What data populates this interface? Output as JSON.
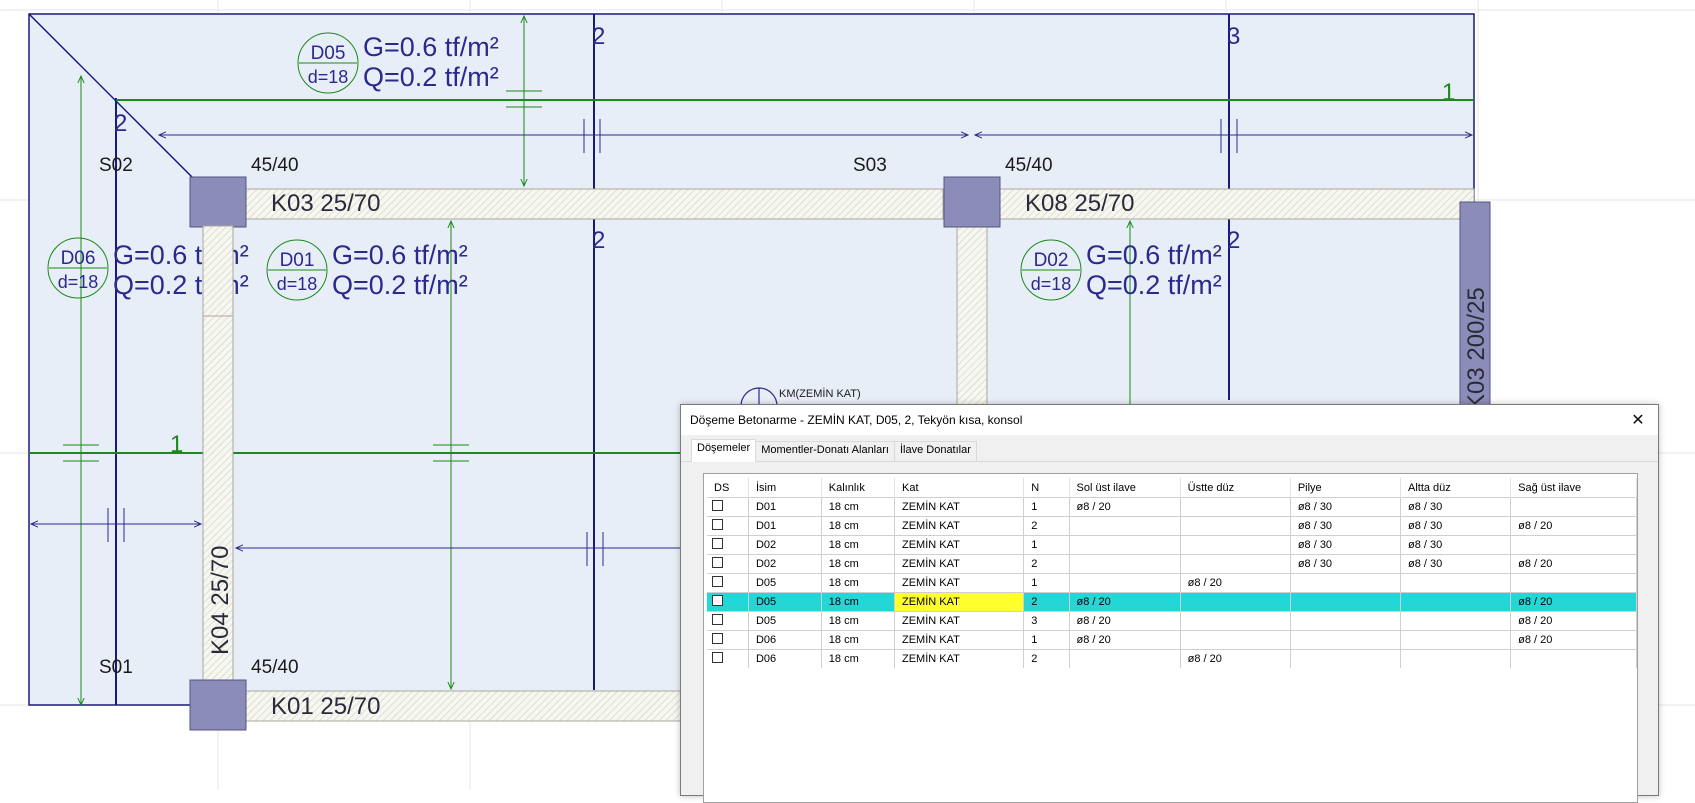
{
  "plan": {
    "axis_labels": {
      "a_top_left": "2",
      "b_top": "2",
      "c_top": "3",
      "a_mid": "2",
      "b_mid": "2",
      "c_mid": "2",
      "row_top_right": "1",
      "row_mid_left": "1"
    },
    "column_dims": {
      "top_left": "45/40",
      "top_mid": "45/40",
      "bottom_left": "45/40"
    },
    "slab_names": {
      "s02": "S02",
      "s03": "S03",
      "s01": "S01"
    },
    "beams": {
      "k03": "K03 25/70",
      "k08": "K08 25/70",
      "k01": "K01 25/70",
      "k04": "K04 25/70",
      "k03v": "K03 200/25"
    },
    "slabs": [
      {
        "id": "D05",
        "d": "d=18",
        "g": "G=0.6 tf/m²",
        "q": "Q=0.2 tf/m²"
      },
      {
        "id": "D06",
        "d": "d=18",
        "g": "G=0.6 tf/m²",
        "q": "Q=0.2 tf/m²"
      },
      {
        "id": "D01",
        "d": "d=18",
        "g": "G=0.6 tf/m²",
        "q": "Q=0.2 tf/m²"
      },
      {
        "id": "D02",
        "d": "d=18",
        "g": "G=0.6 tf/m²",
        "q": "Q=0.2 tf/m²"
      }
    ],
    "level_marker": "KM(ZEMİN KAT)",
    "colors": {
      "axis": "#1a1a7a",
      "load_text": "#2a2a8c",
      "green": "#1a8a1a",
      "slab_fill": "#e8eef7",
      "column_fill": "#8c8cb8"
    }
  },
  "dialog": {
    "title": "Döşeme Betonarme - ZEMİN KAT, D05, 2, Tekyön kısa, konsol",
    "tabs": [
      "Döşemeler",
      "Momentler-Donatı Alanları",
      "İlave Donatılar"
    ],
    "active_tab": 0,
    "columns": [
      "DS",
      "İsim",
      "Kalınlık",
      "Kat",
      "N",
      "Sol üst ilave",
      "Üstte düz",
      "Pilye",
      "Altta düz",
      "Sağ üst ilave"
    ],
    "rows": [
      [
        "",
        "D01",
        "18 cm",
        "ZEMİN KAT",
        "1",
        "ø8 / 20",
        "",
        "ø8 / 30",
        "ø8 / 30",
        ""
      ],
      [
        "",
        "D01",
        "18 cm",
        "ZEMİN KAT",
        "2",
        "",
        "",
        "ø8 / 30",
        "ø8 / 30",
        "ø8 / 20"
      ],
      [
        "",
        "D02",
        "18 cm",
        "ZEMİN KAT",
        "1",
        "",
        "",
        "ø8 / 30",
        "ø8 / 30",
        ""
      ],
      [
        "",
        "D02",
        "18 cm",
        "ZEMİN KAT",
        "2",
        "",
        "",
        "ø8 / 30",
        "ø8 / 30",
        "ø8 / 20"
      ],
      [
        "",
        "D05",
        "18 cm",
        "ZEMİN KAT",
        "1",
        "",
        "ø8 / 20",
        "",
        "",
        ""
      ],
      [
        "",
        "D05",
        "18 cm",
        "ZEMİN KAT",
        "2",
        "ø8 / 20",
        "",
        "",
        "",
        "ø8 / 20"
      ],
      [
        "",
        "D05",
        "18 cm",
        "ZEMİN KAT",
        "3",
        "ø8 / 20",
        "",
        "",
        "",
        "ø8 / 20"
      ],
      [
        "",
        "D06",
        "18 cm",
        "ZEMİN KAT",
        "1",
        "ø8 / 20",
        "",
        "",
        "",
        "ø8 / 20"
      ],
      [
        "",
        "D06",
        "18 cm",
        "ZEMİN KAT",
        "2",
        "",
        "ø8 / 20",
        "",
        "",
        ""
      ]
    ],
    "selected_row": 5,
    "close_icon": "close-icon"
  }
}
